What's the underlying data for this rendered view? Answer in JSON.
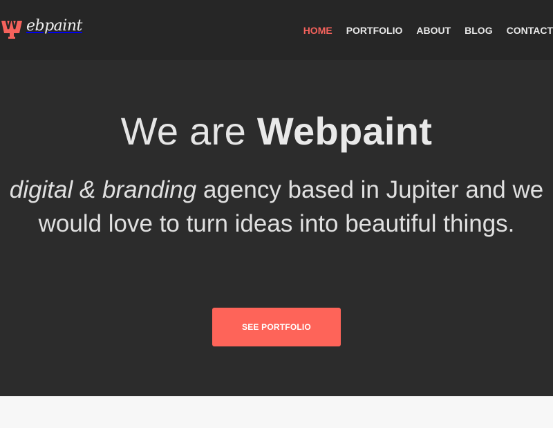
{
  "brand": {
    "logo_text": "ebpaint",
    "accent_color": "#fe6459"
  },
  "nav": {
    "items": [
      {
        "label": "HOME",
        "active": true
      },
      {
        "label": "PORTFOLIO",
        "active": false
      },
      {
        "label": "ABOUT",
        "active": false
      },
      {
        "label": "BLOG",
        "active": false
      },
      {
        "label": "CONTACT",
        "active": false
      }
    ]
  },
  "hero": {
    "title_prefix": "We are ",
    "title_strong": "Webpaint",
    "subtitle_italic": "digital & branding",
    "subtitle_rest": " agency based in Jupiter and we would love to turn ideas into beautiful things.",
    "cta_label": "SEE PORTFOLIO"
  },
  "colors": {
    "header_bg": "#262626",
    "hero_bg": "#2c2c2c",
    "page_bg": "#f7f7f7"
  }
}
